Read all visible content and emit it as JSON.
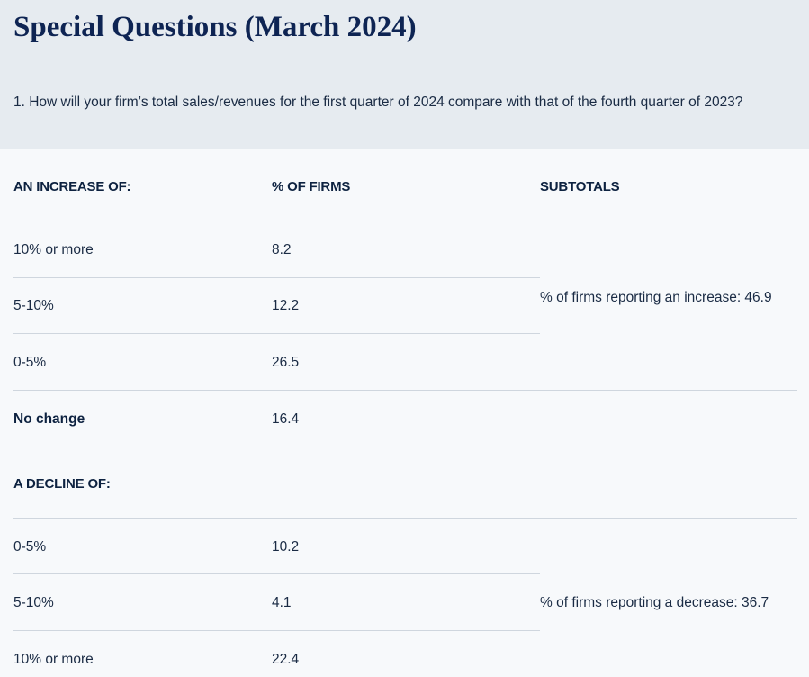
{
  "title": "Special Questions (March 2024)",
  "question": "1. How will your firm’s total sales/revenues for the first quarter of 2024 compare with that of the fourth quarter of 2023?",
  "table": {
    "headers": [
      "AN INCREASE OF:",
      "% OF FIRMS",
      "SUBTOTALS"
    ],
    "increase_rows": [
      {
        "label": "10% or more",
        "value": "8.2"
      },
      {
        "label": "5-10%",
        "value": "12.2"
      },
      {
        "label": "0-5%",
        "value": "26.5"
      }
    ],
    "increase_subtotal": "% of firms reporting an increase: 46.9",
    "no_change": {
      "label": "No change",
      "value": "16.4"
    },
    "decline_header": "A DECLINE OF:",
    "decline_rows": [
      {
        "label": "0-5%",
        "value": "10.2"
      },
      {
        "label": "5-10%",
        "value": "4.1"
      },
      {
        "label": "10% or more",
        "value": "22.4"
      }
    ],
    "decline_subtotal": "% of firms reporting a decrease: 36.7"
  }
}
